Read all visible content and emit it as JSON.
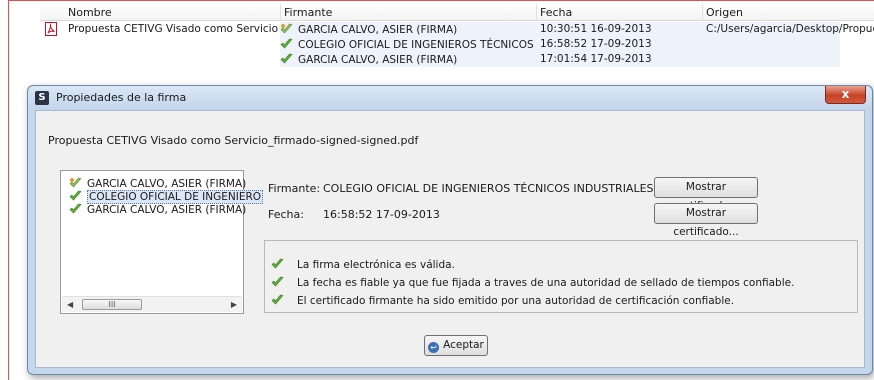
{
  "table": {
    "columns": [
      "Nombre",
      "Firmante",
      "Fecha",
      "Origen"
    ],
    "rows": [
      {
        "nombre": "Propuesta CETIVG Visado como Servicio_fir...",
        "firmante": "GARCIA CALVO, ASIER (FIRMA)",
        "fecha": "10:30:51 16-09-2013",
        "origen": "C:/Users/agarcia/Desktop/Propuest"
      },
      {
        "nombre": "",
        "firmante": "COLEGIO OFICIAL DE INGENIEROS TÉCNICOS IND...",
        "fecha": "16:58:52 17-09-2013",
        "origen": ""
      },
      {
        "nombre": "",
        "firmante": "GARCIA CALVO, ASIER (FIRMA)",
        "fecha": "17:01:54 17-09-2013",
        "origen": ""
      }
    ]
  },
  "dialog": {
    "title": "Propiedades de la firma",
    "title_icon": "S",
    "close_label": "x",
    "file_name": "Propuesta CETIVG Visado como Servicio_firmado-signed-signed.pdf",
    "signers": [
      "GARCIA CALVO, ASIER (FIRMA)",
      "COLEGIO OFICIAL DE INGENIERO",
      "GARCIA CALVO, ASIER (FIRMA)"
    ],
    "scroll_thumb": "III",
    "firmante_label": "Firmante:",
    "firmante_value": "COLEGIO OFICIAL DE INGENIEROS TÉCNICOS INDUSTRIALES PALENCIA",
    "fecha_label": "Fecha:",
    "fecha_value": "16:58:52 17-09-2013",
    "cert_button": "Mostrar certificado...",
    "status": [
      "La firma electrónica es válida.",
      "La fecha es fiable ya que fue fijada a traves de una autoridad de sellado de tiempos confiable.",
      "El certificado firmante ha sido emitido por una autoridad de certificación confiable."
    ],
    "ok_button": "Aceptar"
  },
  "icons": {
    "check": "check-icon",
    "pdf": "pdf-icon",
    "app": "app-logo-icon",
    "close": "close-icon"
  },
  "colors": {
    "check_green": "#5fb23a",
    "titlebar": "#c5d7ed",
    "close_red": "#c64326",
    "pdf_red": "#c8102e"
  }
}
